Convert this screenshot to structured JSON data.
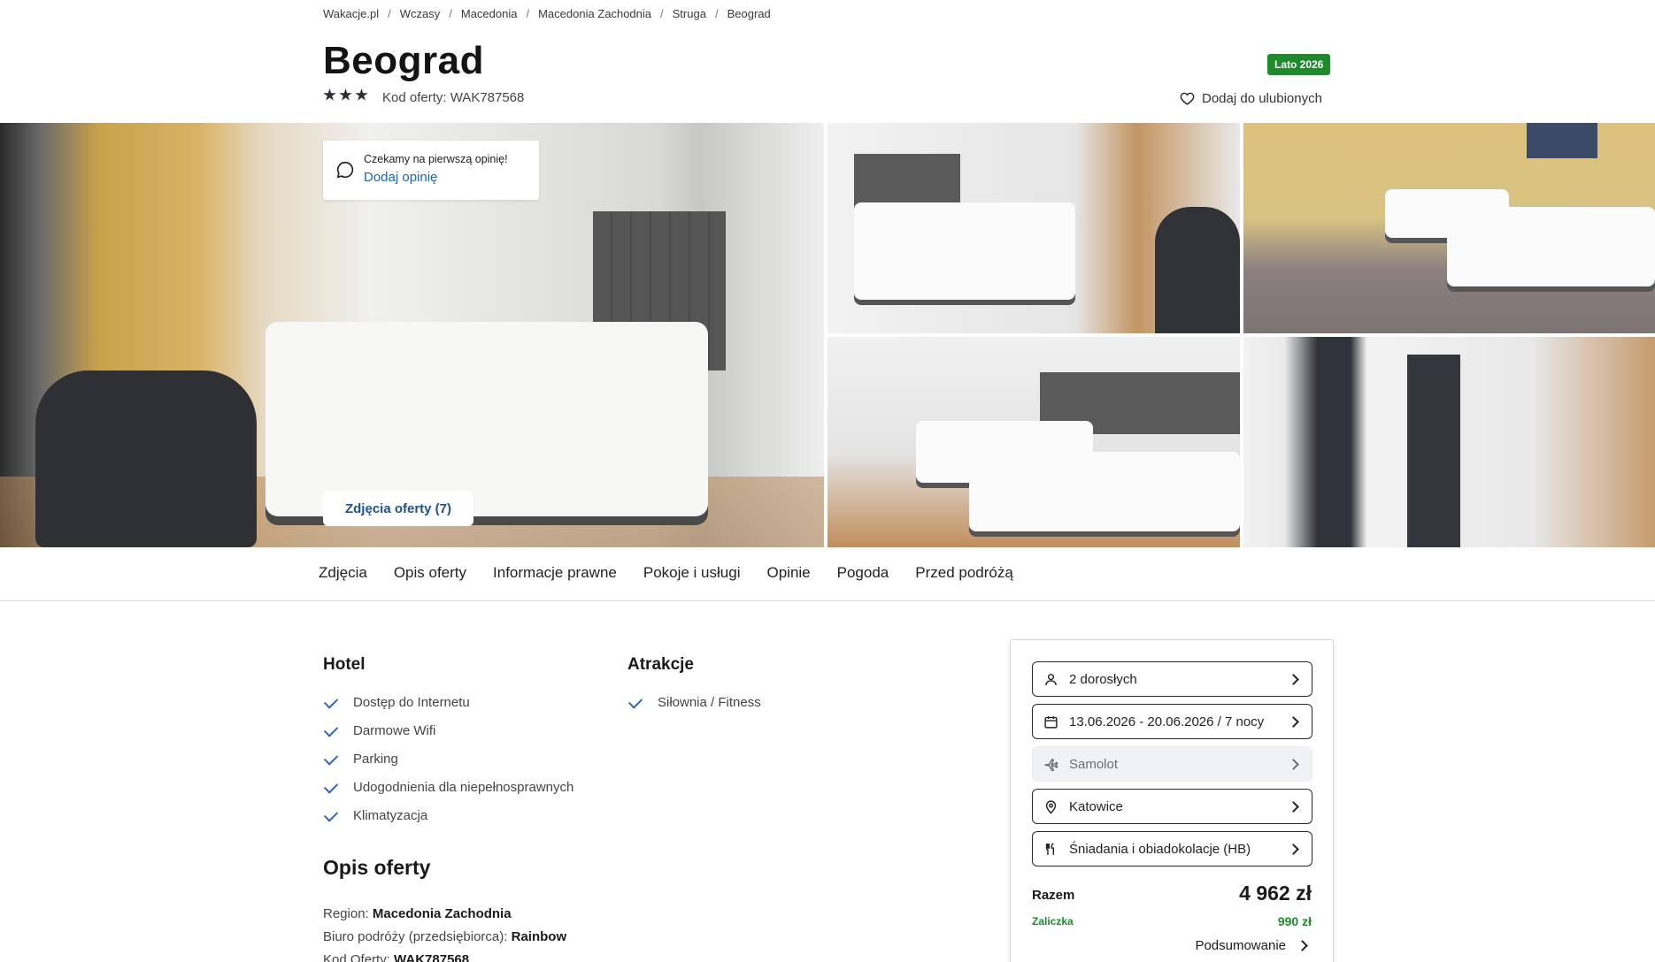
{
  "breadcrumb": [
    "Wakacje.pl",
    "Wczasy",
    "Macedonia",
    "Macedonia Zachodnia",
    "Struga",
    "Beograd"
  ],
  "hotel": {
    "name": "Beograd",
    "stars": 3,
    "offer_code": "Kod oferty: WAK787568",
    "season_badge": "Lato 2026",
    "favorite_label": "Dodaj do ulubionych"
  },
  "gallery": {
    "review_prompt": "Czekamy na pierwszą opinię!",
    "review_link": "Dodaj opinię",
    "photos_button": "Zdjęcia oferty (7)"
  },
  "tabs": [
    "Zdjęcia",
    "Opis oferty",
    "Informacje prawne",
    "Pokoje i usługi",
    "Opinie",
    "Pogoda",
    "Przed podróżą"
  ],
  "amenities": {
    "hotel": {
      "title": "Hotel",
      "items": [
        "Dostęp do Internetu",
        "Darmowe Wifi",
        "Parking",
        "Udogodnienia dla niepełnosprawnych",
        "Klimatyzacja"
      ]
    },
    "attractions": {
      "title": "Atrakcje",
      "items": [
        "Siłownia / Fitness"
      ]
    }
  },
  "description": {
    "title": "Opis oferty",
    "region_label": "Region:",
    "region_value": "Macedonia Zachodnia",
    "operator_label": "Biuro podróży (przedsiębiorca):",
    "operator_value": "Rainbow",
    "code_label": "Kod Oferty:",
    "code_value": "WAK787568"
  },
  "booking": {
    "travelers": "2 dorosłych",
    "dates": "13.06.2026 - 20.06.2026 / 7 nocy",
    "transport": "Samolot",
    "departure": "Katowice",
    "board": "Śniadania i obiadokolacje (HB)",
    "total_label": "Razem",
    "total_value": "4 962 zł",
    "deposit_label": "Zaliczka",
    "deposit_value": "990 zł",
    "summary_label": "Podsumowanie"
  },
  "colors": {
    "accent_green": "#1e8a2c",
    "link_blue": "#1d63b0",
    "check_blue": "#2b66b6"
  }
}
